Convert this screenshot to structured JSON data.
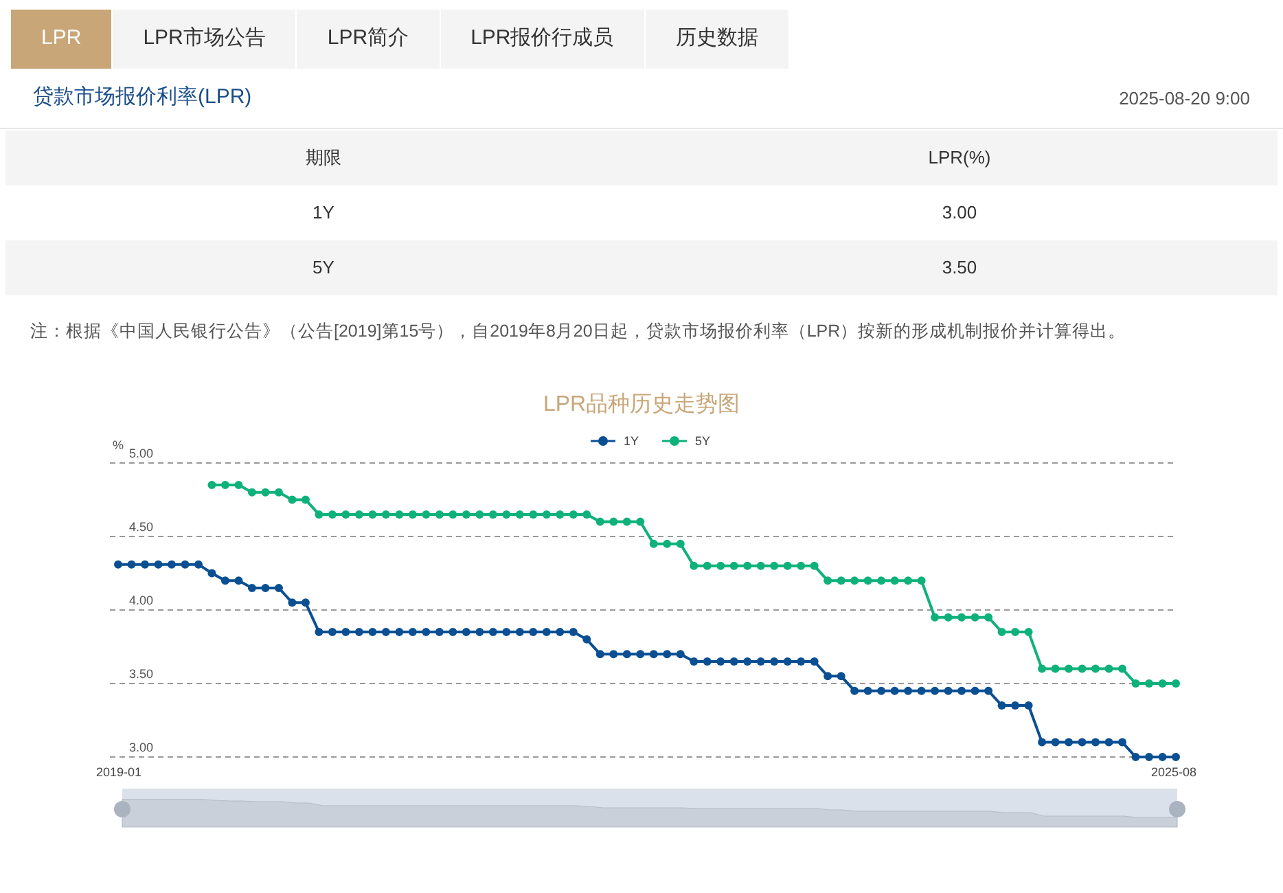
{
  "tabs": [
    {
      "label": "LPR",
      "selected": true
    },
    {
      "label": "LPR市场公告",
      "selected": false
    },
    {
      "label": "LPR简介",
      "selected": false
    },
    {
      "label": "LPR报价行成员",
      "selected": false
    },
    {
      "label": "历史数据",
      "selected": false
    }
  ],
  "header": {
    "title": "贷款市场报价利率(LPR)",
    "datetime": "2025-08-20 9:00"
  },
  "table": {
    "columns": [
      "期限",
      "LPR(%)"
    ],
    "rows": [
      [
        "1Y",
        "3.00"
      ],
      [
        "5Y",
        "3.50"
      ]
    ]
  },
  "note": "注：根据《中国人民银行公告》（公告[2019]第15号），自2019年8月20日起，贷款市场报价利率（LPR）按新的形成机制报价并计算得出。",
  "chart": {
    "x_axis_labels": [
      "2019-01",
      "2025-08"
    ],
    "chart_data": {
      "type": "line",
      "title": "LPR品种历史走势图",
      "ylabel": "%",
      "grid": true,
      "legend": true,
      "series": [
        {
          "name": "1Y",
          "color": "#0b4f93",
          "marker": "circle",
          "values": [
            4.31,
            4.31,
            4.31,
            4.31,
            4.31,
            4.31,
            4.31,
            4.25,
            4.2,
            4.2,
            4.15,
            4.15,
            4.15,
            4.05,
            4.05,
            3.85,
            3.85,
            3.85,
            3.85,
            3.85,
            3.85,
            3.85,
            3.85,
            3.85,
            3.85,
            3.85,
            3.85,
            3.85,
            3.85,
            3.85,
            3.85,
            3.85,
            3.85,
            3.85,
            3.85,
            3.8,
            3.7,
            3.7,
            3.7,
            3.7,
            3.7,
            3.7,
            3.7,
            3.65,
            3.65,
            3.65,
            3.65,
            3.65,
            3.65,
            3.65,
            3.65,
            3.65,
            3.65,
            3.55,
            3.55,
            3.45,
            3.45,
            3.45,
            3.45,
            3.45,
            3.45,
            3.45,
            3.45,
            3.45,
            3.45,
            3.45,
            3.35,
            3.35,
            3.35,
            3.1,
            3.1,
            3.1,
            3.1,
            3.1,
            3.1,
            3.1,
            3.0,
            3.0,
            3.0,
            3.0
          ]
        },
        {
          "name": "5Y",
          "color": "#0fb17b",
          "marker": "circle",
          "values": [
            null,
            null,
            null,
            null,
            null,
            null,
            null,
            4.85,
            4.85,
            4.85,
            4.8,
            4.8,
            4.8,
            4.75,
            4.75,
            4.65,
            4.65,
            4.65,
            4.65,
            4.65,
            4.65,
            4.65,
            4.65,
            4.65,
            4.65,
            4.65,
            4.65,
            4.65,
            4.65,
            4.65,
            4.65,
            4.65,
            4.65,
            4.65,
            4.65,
            4.65,
            4.6,
            4.6,
            4.6,
            4.6,
            4.45,
            4.45,
            4.45,
            4.3,
            4.3,
            4.3,
            4.3,
            4.3,
            4.3,
            4.3,
            4.3,
            4.3,
            4.3,
            4.2,
            4.2,
            4.2,
            4.2,
            4.2,
            4.2,
            4.2,
            4.2,
            3.95,
            3.95,
            3.95,
            3.95,
            3.95,
            3.85,
            3.85,
            3.85,
            3.6,
            3.6,
            3.6,
            3.6,
            3.6,
            3.6,
            3.6,
            3.5,
            3.5,
            3.5,
            3.5
          ]
        }
      ],
      "ylim": [
        3,
        5
      ],
      "yticks": [
        {
          "value": 3,
          "label": "3.00"
        },
        {
          "value": 3.5,
          "label": "3.50"
        },
        {
          "value": 4,
          "label": "4.00"
        },
        {
          "value": 4.5,
          "label": "4.50"
        },
        {
          "value": 5,
          "label": "5.00"
        }
      ]
    }
  }
}
